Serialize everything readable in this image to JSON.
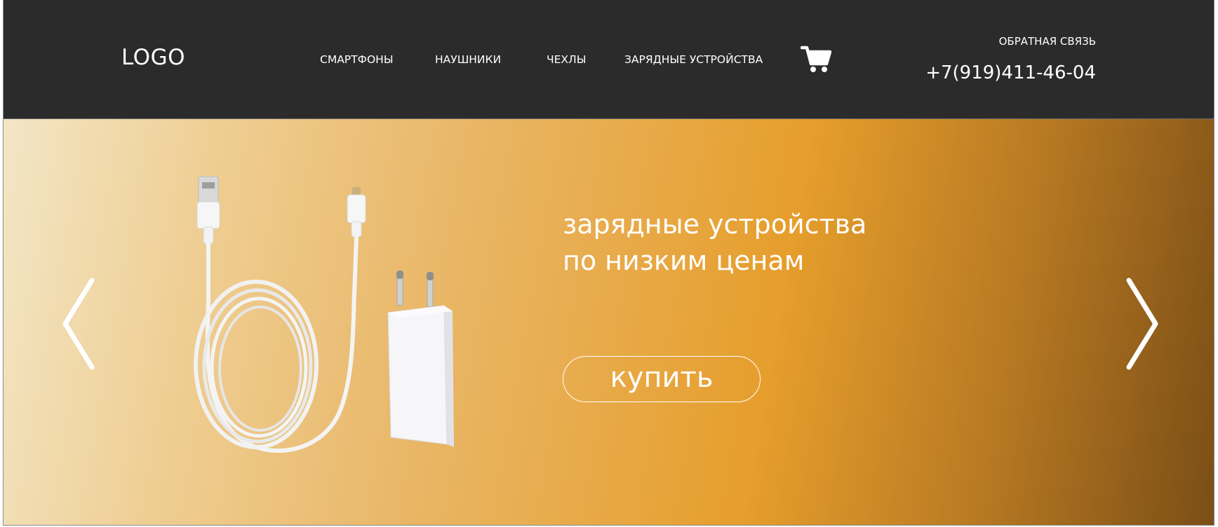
{
  "header": {
    "logo": "LOGO",
    "nav": [
      {
        "label": "СМАРТФОНЫ"
      },
      {
        "label": "НАУШНИКИ"
      },
      {
        "label": "ЧЕХЛЫ"
      },
      {
        "label": "ЗАРЯДНЫЕ УСТРОЙСТВА"
      }
    ],
    "cart_icon": "cart-icon",
    "contact_label": "ОБРАТНАЯ СВЯЗЬ",
    "phone": "+7(919)411-46-04"
  },
  "hero": {
    "headline_line1": "зарядные устройства",
    "headline_line2": "по низким ценам",
    "buy_label": "купить",
    "prev_icon": "chevron-left-icon",
    "next_icon": "chevron-right-icon",
    "product_image": "usb-cable-and-charger-image"
  },
  "colors": {
    "header_bg": "#2b2b2b",
    "hero_gradient": [
      "#f3e6c6",
      "#efcf95",
      "#e9b768",
      "#e69e2c",
      "#b67822",
      "#7a4e16"
    ],
    "text": "#ffffff"
  }
}
